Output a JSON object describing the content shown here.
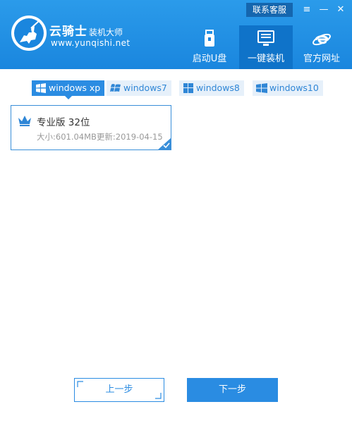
{
  "header": {
    "brand_title": "云骑士",
    "brand_subtitle": "装机大师",
    "brand_url": "www.yunqishi.net",
    "support_label": "联系客服",
    "menu_glyph": "≡",
    "minimize_glyph": "—",
    "close_glyph": "✕",
    "nav": [
      {
        "label": "启动U盘",
        "icon": "usb-drive-icon",
        "active": false
      },
      {
        "label": "一键装机",
        "icon": "monitor-icon",
        "active": true
      },
      {
        "label": "官方网址",
        "icon": "ie-browser-icon",
        "active": false
      }
    ]
  },
  "os_tabs": [
    {
      "label": "windows xp",
      "active": true
    },
    {
      "label": "windows7",
      "active": false
    },
    {
      "label": "windows8",
      "active": false
    },
    {
      "label": "windows10",
      "active": false
    }
  ],
  "editions": [
    {
      "name": "专业版 32位",
      "meta": "大小:601.04MB更新:2019-04-15",
      "selected": true
    }
  ],
  "footer": {
    "prev_label": "上一步",
    "next_label": "下一步"
  },
  "colors": {
    "header": "#1a86de",
    "active_nav": "#0f73c9",
    "accent": "#2b8ce2",
    "support_bg": "#1566ae"
  }
}
